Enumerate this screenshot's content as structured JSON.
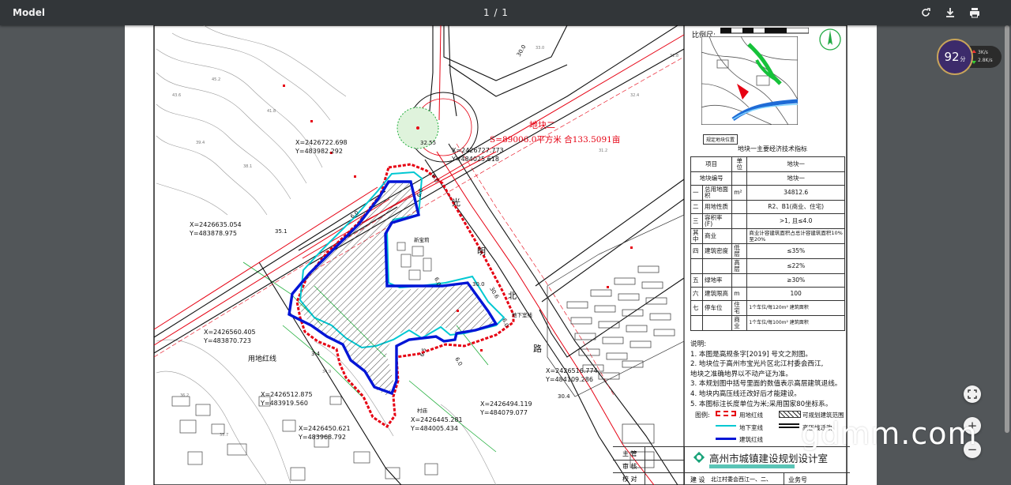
{
  "toolbar": {
    "title": "Model",
    "pager": "1 / 1",
    "icons": [
      "rotate-icon",
      "download-icon",
      "print-icon"
    ]
  },
  "plan": {
    "parcel2_name": "地块二",
    "parcel2_area": "S=89006.0平方米 合133.5091亩",
    "road_chars": [
      "光",
      "明",
      "北",
      "路"
    ],
    "new_building": "新宝莉",
    "basement": "地下室线",
    "land_line": "用地红线",
    "village": "村庙",
    "dims": [
      "30.0",
      "32.55",
      "6.0",
      "30.0",
      "35.1",
      "30.6",
      "6.0",
      "6.0",
      "6.0",
      "6.5",
      "6.0",
      "3.4",
      "6.0",
      "30.4"
    ],
    "coords": [
      {
        "x": "X=2426722.698",
        "y": "Y=483982.292"
      },
      {
        "x": "X=2426727.773",
        "y": "Y=484025.618"
      },
      {
        "x": "X=2426635.054",
        "y": "Y=483878.975"
      },
      {
        "x": "X=2426560.405",
        "y": "Y=483870.723"
      },
      {
        "x": "X=2426512.875",
        "y": "Y=483919.560"
      },
      {
        "x": "X=2426450.621",
        "y": "Y=483968.792"
      },
      {
        "x": "X=2426445.281",
        "y": "Y=484005.434"
      },
      {
        "x": "X=2426494.119",
        "y": "Y=484079.077"
      },
      {
        "x": "X=2426516.774",
        "y": "Y=484109.286"
      }
    ]
  },
  "panel": {
    "scale_label": "比例尺:",
    "location_label": "规定地块位置",
    "eco_title": "地块一主要经济技术指标",
    "table": {
      "headers": [
        "项目",
        "单位",
        "地块一"
      ],
      "r1": [
        "地块编号",
        "地块一"
      ],
      "r2": [
        "一",
        "总用地面积",
        "m²",
        "34812.6"
      ],
      "r3": [
        "二",
        "用地性质",
        "R2、B1(商业、住宅)"
      ],
      "r4": [
        "三",
        "容积率 (F)",
        ">1, 且≤4.0"
      ],
      "r5": [
        "其中",
        "商业",
        "商业计容建筑面积占总计容建筑面积10%至20%"
      ],
      "r6": [
        "四",
        "建筑密度",
        "低层",
        "≤35%"
      ],
      "r7": [
        "高层",
        "≤22%"
      ],
      "r8": [
        "五",
        "绿地率",
        "≥30%"
      ],
      "r9": [
        "六",
        "建筑限高",
        "m",
        "100"
      ],
      "r10": [
        "七",
        "停车位",
        "住宅",
        "1个车位/每120m² 建筑面积"
      ],
      "r11": [
        "商业",
        "1个车位/每100m² 建筑面积"
      ]
    },
    "notes_title": "说明:",
    "notes": [
      "1. 本图是高规条字[2019]     号文之附图。",
      "2. 地块位于高州市宝光片区北江村委会西江,",
      "   地块之准确地界以不动产证为准。",
      "3. 本规划图中括号里面的数值表示高层建筑退线。",
      "4. 地块内高压线迁改好后才能建设。",
      "5. 本图标注长度单位为米;采用国家80坐标系。"
    ],
    "legend_title": "图例:",
    "legend": [
      "用地红线",
      "可规划建筑范围",
      "地下室线",
      "高压线迁改",
      "建筑红线"
    ],
    "footer": {
      "zhuguan": "主  管",
      "shenhe": "审  核",
      "jiaodui": "校  对",
      "company": "高州市城镇建设规划设计室",
      "jianshe": "建 设",
      "jianshe_val": "北江村委会西江一、二、",
      "yewuhao": "业务号"
    }
  },
  "badge": {
    "score": "92",
    "score_unit": "分",
    "up": "3K/s",
    "down": "2.8K/s"
  },
  "watermark": "gdmm.com",
  "colors": {
    "toolbar": "#323639",
    "viewer_bg": "#525659",
    "red_line": "#e60012",
    "blue_line": "#0015d6",
    "cyan_line": "#00c8d2"
  }
}
